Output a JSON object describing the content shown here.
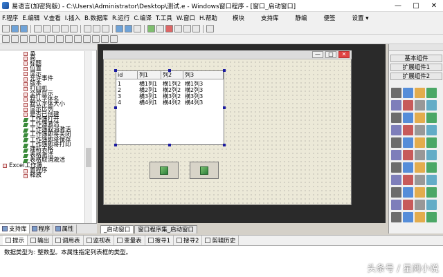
{
  "window": {
    "title": "易语言(加密狗版) - C:\\Users\\Administrator\\Desktop\\测试.e - Windows窗口程序 - [窗口_启动窗口]",
    "minimize": "—",
    "restore": "□",
    "close": "✕"
  },
  "menu": {
    "items": [
      "F.程序",
      "E.编辑",
      "V.查看",
      "I.插入",
      "B.数据库",
      "R.运行",
      "C.编译",
      "T.工具",
      "W.窗口",
      "H.帮助"
    ],
    "right": [
      "模块",
      "支持库",
      "静编",
      "便签",
      "设置 ▾"
    ]
  },
  "toolbar": {
    "run_label": "",
    "ident_label": ""
  },
  "tree": {
    "items": [
      {
        "label": "宽",
        "icon": "property"
      },
      {
        "label": "高",
        "icon": "property"
      },
      {
        "label": "标题",
        "icon": "property"
      },
      {
        "label": "位置",
        "icon": "property"
      },
      {
        "label": "显示",
        "icon": "property"
      },
      {
        "label": "允许事件",
        "icon": "property"
      },
      {
        "label": "版本",
        "icon": "property"
      },
      {
        "label": "打印机",
        "icon": "property"
      },
      {
        "label": "全屏显示",
        "icon": "property"
      },
      {
        "label": "默认字体名",
        "icon": "property"
      },
      {
        "label": "默认字体大小",
        "icon": "property"
      },
      {
        "label": "显示比例",
        "icon": "property"
      },
      {
        "label": "是否已创建",
        "icon": "property"
      },
      {
        "label": "工作簿打开",
        "icon": "event"
      },
      {
        "label": "工作簿激活",
        "icon": "event"
      },
      {
        "label": "工作簿取消激活",
        "icon": "event"
      },
      {
        "label": "工作簿即将关闭",
        "icon": "event"
      },
      {
        "label": "工作簿即将保存",
        "icon": "event"
      },
      {
        "label": "工作簿即将打印",
        "icon": "event"
      },
      {
        "label": "建新表格",
        "icon": "event"
      },
      {
        "label": "表格激活",
        "icon": "event"
      },
      {
        "label": "表格取消激活",
        "icon": "event"
      },
      {
        "label": "Excel工作簿",
        "icon": "class"
      },
      {
        "label": "置程序",
        "icon": "property"
      },
      {
        "label": "释放",
        "icon": "property"
      }
    ]
  },
  "left_tabs": [
    "支持库",
    "程序",
    "属性"
  ],
  "table": {
    "headers": [
      "id",
      "列1",
      "列2",
      "列3"
    ],
    "rows": [
      [
        "1",
        "横1列1",
        "横1列2",
        "横1列3"
      ],
      [
        "2",
        "横2列1",
        "横2列2",
        "横2列3"
      ],
      [
        "3",
        "横3列1",
        "横3列2",
        "横3列3"
      ],
      [
        "4",
        "横4列1",
        "横4列2",
        "横4列3"
      ]
    ]
  },
  "design_tabs": [
    "_启动窗口",
    "窗口程序集_启动窗口"
  ],
  "right_panel": {
    "buttons": [
      "基本组件",
      "扩展组件1",
      "扩展组件2"
    ],
    "palette_items": 44
  },
  "bottom_tabs": [
    "提示",
    "输出",
    "调用表",
    "监视表",
    "变量表",
    "搜寻1",
    "搜寻2",
    "剪辑历史"
  ],
  "output": {
    "text": "数据类型为: 整数型。本属性指定列表框的类型。"
  },
  "watermark": "头条号 / 星阅小说",
  "colors": {
    "design_bg": "#2a2a2a",
    "form_bg": "#ece9d8",
    "close": "#e04343"
  }
}
